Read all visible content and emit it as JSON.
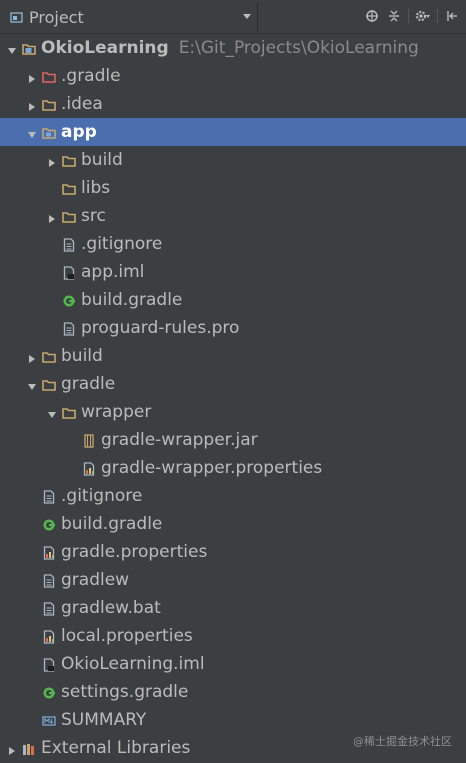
{
  "toolbar": {
    "view_label": "Project",
    "view_icon": "project-view-icon",
    "icons": [
      "locate-icon",
      "collapse-all-icon",
      "settings-icon",
      "hide-panel-icon"
    ]
  },
  "colors": {
    "background": "#3c3f41",
    "selection": "#4b6eaf",
    "text": "#bbbbbb",
    "path_text": "#8a8a8a",
    "folder": "#c9a66b",
    "excluded_folder": "#e0645c",
    "gradle_green": "#52b84a"
  },
  "tree": [
    {
      "label": "OkioLearning",
      "path": "E:\\Git_Projects\\OkioLearning",
      "icon": "module-icon",
      "arrow": "down",
      "bold": true
    },
    {
      "label": ".gradle",
      "icon": "excluded-folder-icon",
      "arrow": "right"
    },
    {
      "label": ".idea",
      "icon": "folder-icon",
      "arrow": "right"
    },
    {
      "label": "app",
      "icon": "module-folder-icon",
      "arrow": "down",
      "bold": true,
      "selected": true
    },
    {
      "label": "build",
      "icon": "folder-icon",
      "arrow": "right"
    },
    {
      "label": "libs",
      "icon": "folder-icon",
      "arrow": "none"
    },
    {
      "label": "src",
      "icon": "folder-icon",
      "arrow": "right"
    },
    {
      "label": ".gitignore",
      "icon": "text-file-icon",
      "arrow": "none"
    },
    {
      "label": "app.iml",
      "icon": "iml-file-icon",
      "arrow": "none"
    },
    {
      "label": "build.gradle",
      "icon": "gradle-file-icon",
      "arrow": "none"
    },
    {
      "label": "proguard-rules.pro",
      "icon": "text-file-icon",
      "arrow": "none"
    },
    {
      "label": "build",
      "icon": "folder-icon",
      "arrow": "right"
    },
    {
      "label": "gradle",
      "icon": "folder-icon",
      "arrow": "down"
    },
    {
      "label": "wrapper",
      "icon": "folder-icon",
      "arrow": "down"
    },
    {
      "label": "gradle-wrapper.jar",
      "icon": "jar-file-icon",
      "arrow": "none"
    },
    {
      "label": "gradle-wrapper.properties",
      "icon": "properties-file-icon",
      "arrow": "none"
    },
    {
      "label": ".gitignore",
      "icon": "text-file-icon",
      "arrow": "none"
    },
    {
      "label": "build.gradle",
      "icon": "gradle-file-icon",
      "arrow": "none"
    },
    {
      "label": "gradle.properties",
      "icon": "properties-file-icon",
      "arrow": "none"
    },
    {
      "label": "gradlew",
      "icon": "text-file-icon",
      "arrow": "none"
    },
    {
      "label": "gradlew.bat",
      "icon": "text-file-icon",
      "arrow": "none"
    },
    {
      "label": "local.properties",
      "icon": "properties-file-icon",
      "arrow": "none"
    },
    {
      "label": "OkioLearning.iml",
      "icon": "iml-file-icon",
      "arrow": "none"
    },
    {
      "label": "settings.gradle",
      "icon": "gradle-file-icon",
      "arrow": "none"
    },
    {
      "label": "SUMMARY",
      "icon": "markdown-file-icon",
      "arrow": "none"
    },
    {
      "label": "External Libraries",
      "icon": "libraries-icon",
      "arrow": "right"
    }
  ],
  "watermark": "@稀土掘金技术社区"
}
